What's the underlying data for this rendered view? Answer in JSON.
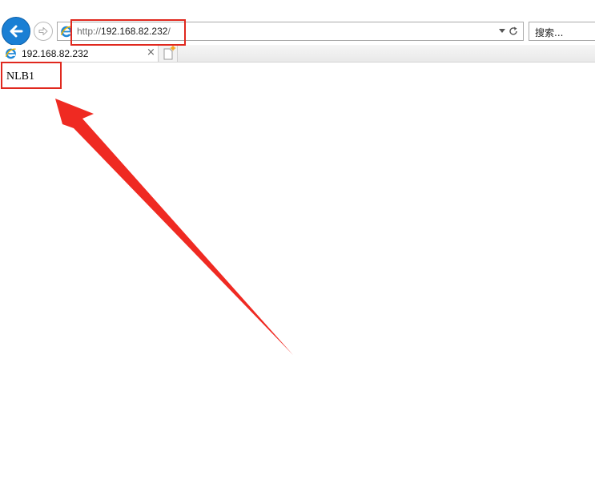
{
  "browser": {
    "address": {
      "protocol": "http://",
      "host": "192.168.82.232",
      "trailing": "/"
    },
    "search_placeholder": "搜索...",
    "tab": {
      "title": "192.168.82.232",
      "close_glyph": "×"
    },
    "icons": [
      "back-arrow-icon",
      "forward-arrow-icon",
      "ie-logo-icon",
      "dropdown-icon",
      "refresh-icon",
      "new-tab-icon"
    ]
  },
  "page": {
    "body_text": "NLB1"
  },
  "annotations": {
    "color": "#e0281e"
  },
  "colors": {
    "back_button": "#1a7fd4",
    "ie_icon_blue": "#1e88d8",
    "ie_icon_gold": "#f0b400"
  }
}
